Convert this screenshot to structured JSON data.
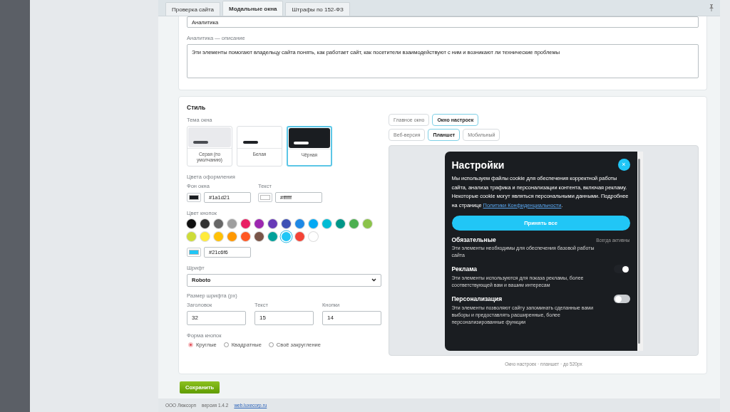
{
  "tabs": [
    {
      "label": "Проверка сайта",
      "selected": false
    },
    {
      "label": "Модальные окна",
      "selected": true
    },
    {
      "label": "Штрафы по 152-ФЗ",
      "selected": false
    }
  ],
  "analytics": {
    "name_value": "Аналитика",
    "description_label": "Аналитика — описание",
    "description_value": "Эти элементы помогают владельцу сайта понять, как работает сайт, как посетители взаимодействуют с ним и возникают ли технические проблемы"
  },
  "style": {
    "title": "Стиль",
    "theme_label": "Тема окна",
    "themes": [
      {
        "label": "Серая (по умолчанию)",
        "kind": "gray",
        "selected": false
      },
      {
        "label": "Белая",
        "kind": "white",
        "selected": false
      },
      {
        "label": "Чёрная",
        "kind": "black",
        "selected": true
      }
    ],
    "colors_label": "Цвета оформления",
    "bg_label": "Фон окна",
    "bg_value": "#1a1d21",
    "text_label": "Текст",
    "text_value": "#ffffff",
    "buttons_color_label": "Цвет кнопок",
    "swatches": [
      {
        "color": "#111111",
        "selected": false
      },
      {
        "color": "#333333",
        "selected": false
      },
      {
        "color": "#666666",
        "selected": false
      },
      {
        "color": "#9e9e9e",
        "selected": false
      },
      {
        "color": "#e91e63",
        "selected": false
      },
      {
        "color": "#9c27b0",
        "selected": false
      },
      {
        "color": "#673ab7",
        "selected": false
      },
      {
        "color": "#3f51b5",
        "selected": false
      },
      {
        "color": "#1e88e5",
        "selected": false
      },
      {
        "color": "#03a9f4",
        "selected": false
      },
      {
        "color": "#00bcd4",
        "selected": false
      },
      {
        "color": "#009688",
        "selected": false
      },
      {
        "color": "#4caf50",
        "selected": false
      },
      {
        "color": "#8bc34a",
        "selected": false
      },
      {
        "color": "#cddc39",
        "selected": false
      },
      {
        "color": "#ffeb3b",
        "selected": false
      },
      {
        "color": "#ffc107",
        "selected": false
      },
      {
        "color": "#ff9800",
        "selected": false
      },
      {
        "color": "#ff5722",
        "selected": false
      },
      {
        "color": "#795548",
        "selected": false
      },
      {
        "color": "#00a19a",
        "selected": false
      },
      {
        "color": "#21c6f6",
        "selected": true
      },
      {
        "color": "#f44336",
        "selected": false
      },
      {
        "color": "#ffffff",
        "selected": false
      }
    ],
    "button_color_value": "#21c6f6",
    "font_label": "Шрифт",
    "font_value": "Roboto",
    "size_label": "Размер шрифта (px)",
    "sizes": [
      {
        "label": "Заголовок",
        "value": "32"
      },
      {
        "label": "Текст",
        "value": "15"
      },
      {
        "label": "Кнопки",
        "value": "14"
      }
    ],
    "shape_label": "Форма кнопок",
    "shapes": [
      {
        "label": "Круглые",
        "selected": true
      },
      {
        "label": "Квадратные",
        "selected": false
      },
      {
        "label": "Своё закругление",
        "selected": false
      }
    ]
  },
  "preview": {
    "window_tabs": [
      {
        "label": "Главное окно",
        "selected": false
      },
      {
        "label": "Окно настроек",
        "selected": true
      }
    ],
    "device_tabs": [
      {
        "label": "Веб-версия",
        "selected": false
      },
      {
        "label": "Планшет",
        "selected": true
      },
      {
        "label": "Мобильный",
        "selected": false
      }
    ],
    "modal": {
      "title": "Настройки",
      "close": "×",
      "text": "Мы используем файлы cookie для обеспечения корректной работы сайта, анализа трафика и персонализации контента, включая рекламу. Некоторые cookie могут являться персональными данными. Подробнее на странице ",
      "link": "Политики Конфиденциальности",
      "text_end": ".",
      "accept": "Принять все",
      "categories": [
        {
          "title": "Обязательные",
          "kind": "always",
          "status": "Всегда активны",
          "description": "Эти элементы необходимы для обеспечения базовой работы сайта"
        },
        {
          "title": "Реклама",
          "kind": "toggle",
          "on": true,
          "description": "Эти элементы используются для показа рекламы, более соответствующей вам и вашим интересам"
        },
        {
          "title": "Персонализация",
          "kind": "toggle",
          "on": false,
          "description": "Эти элементы позволяют сайту запоминать сделанные вами выборы и предоставлять расширенные, более персонализированные функции"
        }
      ]
    },
    "caption": "Окно настроек · планшет · до 520px"
  },
  "save": "Сохранить",
  "footer": {
    "company": "ООО Люксорп",
    "version": "версия 1.4.2",
    "link": "web.luxecorp.ru"
  }
}
